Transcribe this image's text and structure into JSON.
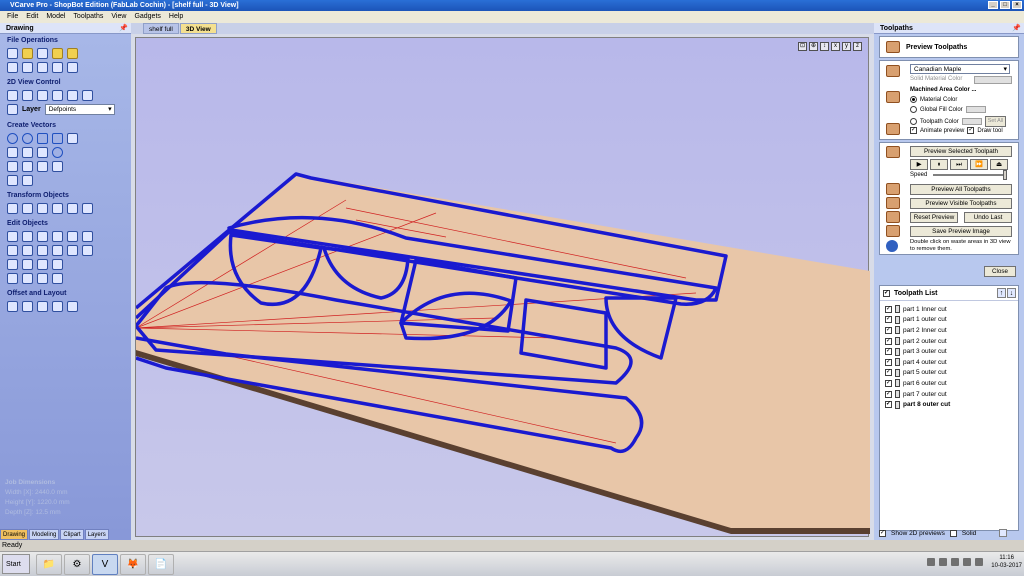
{
  "window": {
    "title": "VCarve Pro - ShopBot Edition (FabLab Cochin) - [shelf full - 3D View]"
  },
  "menu": [
    "File",
    "Edit",
    "Model",
    "Toolpaths",
    "View",
    "Gadgets",
    "Help"
  ],
  "left_panel": {
    "title": "Drawing",
    "sections": {
      "file_ops": "File Operations",
      "view_control": "2D View Control",
      "create_vectors": "Create Vectors",
      "transform": "Transform Objects",
      "edit": "Edit Objects",
      "offset": "Offset and Layout"
    },
    "layer_label": "Layer",
    "layer_value": "Defpoints",
    "job_dims": {
      "title": "Job Dimensions",
      "width": "Width  [X]: 2440.0 mm",
      "height": "Height [Y]: 1220.0 mm",
      "depth": "Depth  [Z]: 12.5 mm"
    },
    "tabs": [
      "Drawing",
      "Modeling",
      "Clipart",
      "Layers"
    ]
  },
  "doc_tabs": [
    "shelf full",
    "3D View"
  ],
  "right_panel": {
    "title": "Toolpaths",
    "preview_title": "Preview Toolpaths",
    "material": "Canadian Maple",
    "solid_material_color": "Solid Material Color",
    "machined_area_color": "Machined Area Color ...",
    "material_color": "Material Color",
    "global_fill_color": "Global Fill Color",
    "toolpath_color": "Toolpath Color",
    "set_all": "Set All",
    "animate_preview": "Animate preview",
    "draw_tool": "Draw tool",
    "preview_selected": "Preview Selected Toolpath",
    "speed": "Speed",
    "preview_all": "Preview All Toolpaths",
    "preview_visible": "Preview Visible Toolpaths",
    "reset_preview": "Reset Preview",
    "undo_last": "Undo Last",
    "save_preview": "Save Preview Image",
    "hint": "Double click on waste areas in 3D view to remove them.",
    "close": "Close",
    "toolpath_list_title": "Toolpath List",
    "toolpaths": [
      "part 1 Inner cut",
      "part 1 outer cut",
      "part 2 Inner cut",
      "part 2 outer cut",
      "part 3 outer cut",
      "part 4 outer cut",
      "part 5 outer cut",
      "part 6 outer cut",
      "part 7 outer cut",
      "part 8 outer cut"
    ],
    "show_2d_previews": "Show 2D previews",
    "solid": "Solid"
  },
  "status": {
    "text": "Ready"
  },
  "taskbar": {
    "start": "Start",
    "time": "11:16",
    "date": "10-03-2017"
  },
  "colors": {
    "toolpath": "#1a1ad0",
    "board": "#e8c4a8",
    "background_top": "#b8b8ea"
  }
}
